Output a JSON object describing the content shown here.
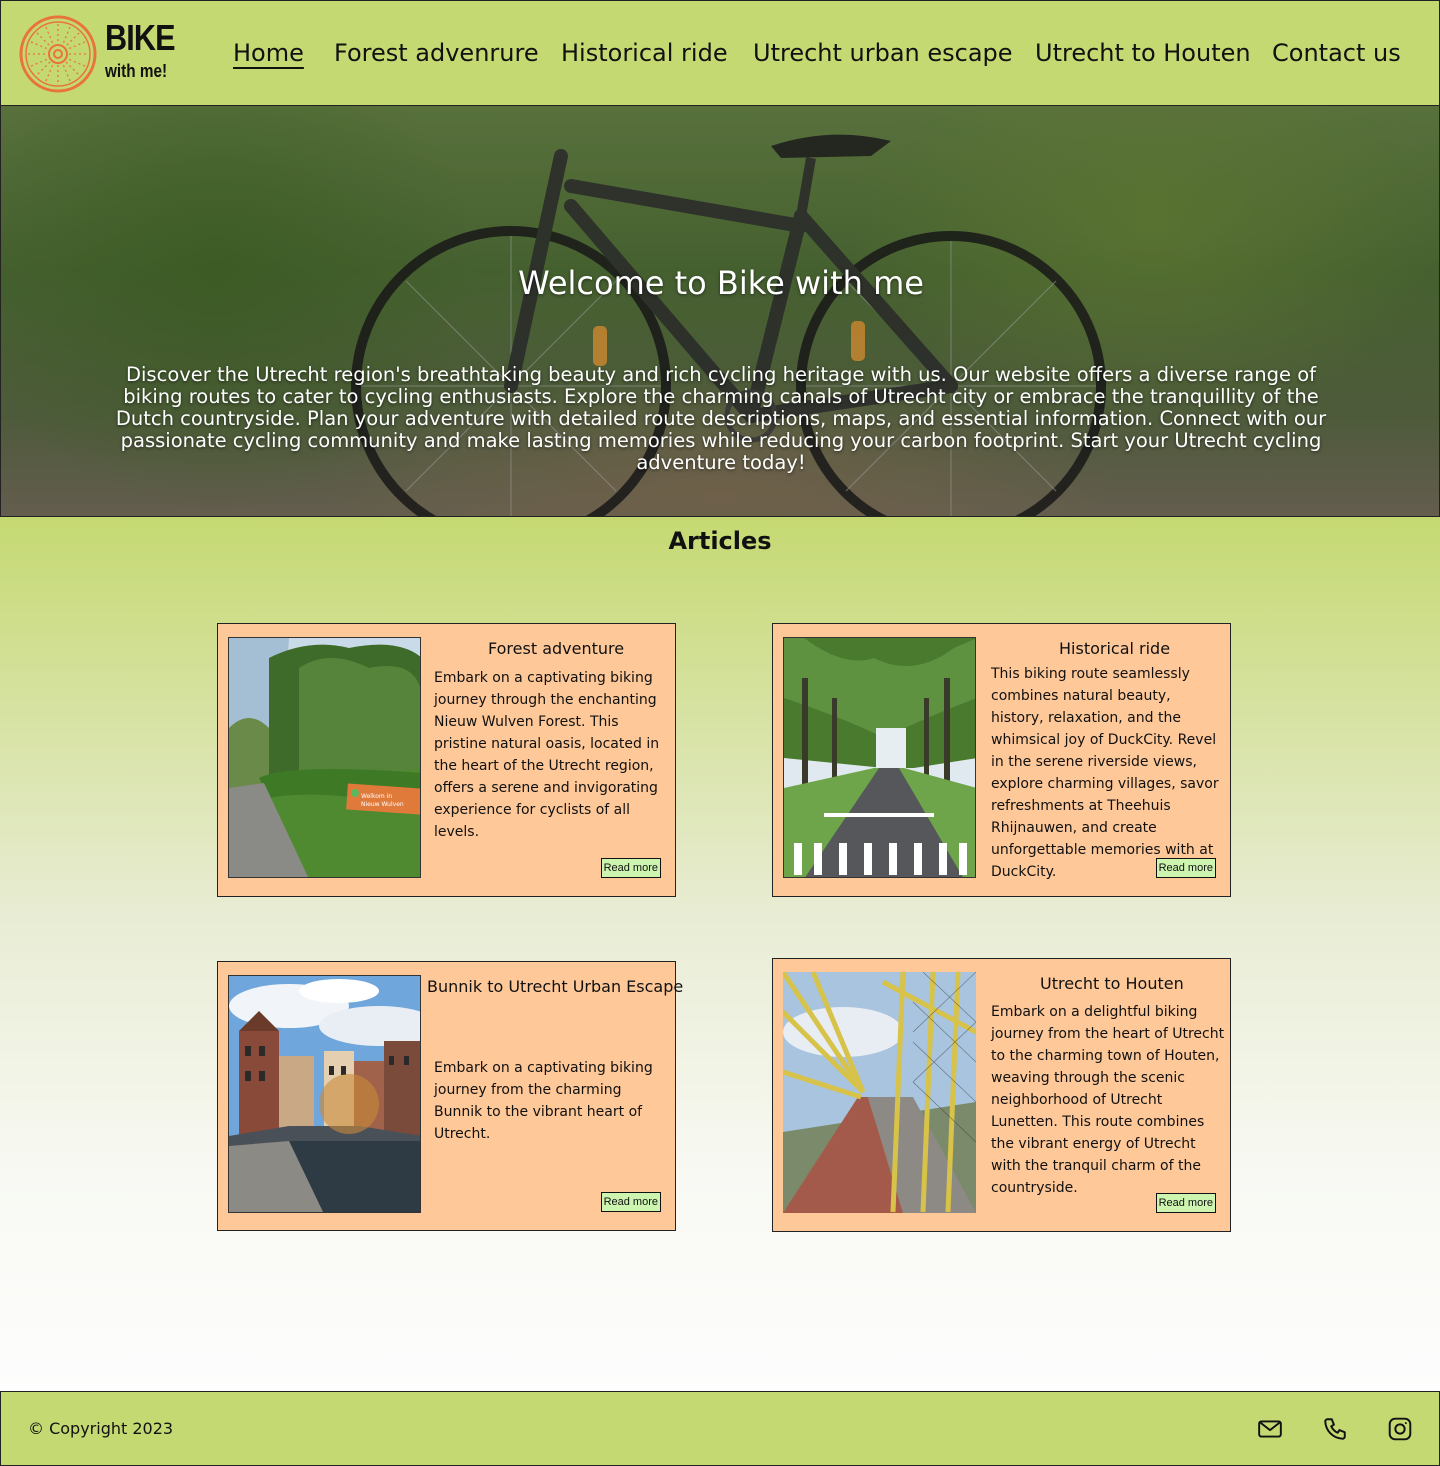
{
  "header": {
    "logo_word": "BIKE",
    "logo_sub": "with me!",
    "nav": [
      "Home",
      "Forest advenrure",
      "Historical ride",
      "Utrecht urban escape",
      "Utrecht to Houten",
      "Contact us"
    ],
    "active": "Home"
  },
  "hero": {
    "title": "Welcome to Bike with me",
    "text": "Discover the Utrecht region's breathtaking beauty and rich cycling heritage with us. Our website offers a diverse range of biking routes to cater to cycling enthusiasts. Explore the charming canals of Utrecht city or embrace the tranquillity of the Dutch countryside. Plan your adventure with detailed route descriptions, maps, and essential information. Connect with our passionate cycling community and make lasting memories while reducing your carbon footprint. Start your Utrecht cycling adventure today!"
  },
  "articles": {
    "heading": "Articles",
    "items": [
      {
        "title": "Forest adventure",
        "desc": "Embark on a captivating biking journey through the enchanting Nieuw Wulven Forest. This pristine natural oasis, located in the heart of the Utrecht region, offers a serene and invigorating experience for cyclists of all levels.",
        "button": "Read more",
        "sign_text": "Welkom in Nieuw Wulven"
      },
      {
        "title": "Historical ride",
        "desc": "This biking route seamlessly combines natural beauty, history, relaxation, and the whimsical joy of DuckCity. Revel in the serene riverside views, explore charming villages, savor refreshments at Theehuis Rhijnauwen, and create unforgettable memories with at DuckCity.",
        "button": "Read more"
      },
      {
        "title": "Bunnik to Utrecht Urban Escape",
        "desc": "Embark on a captivating biking journey from the charming Bunnik to the vibrant heart of Utrecht.",
        "button": "Read more"
      },
      {
        "title": "Utrecht to Houten",
        "desc": "Embark on a delightful biking journey from the heart of Utrecht to the charming town of Houten, weaving through the scenic neighborhood of Utrecht Lunetten. This route combines the vibrant energy of Utrecht with the tranquil charm of the countryside.",
        "button": "Read more"
      }
    ]
  },
  "footer": {
    "copyright": "© Copyright 2023",
    "icons": [
      "mail-icon",
      "phone-icon",
      "instagram-icon"
    ]
  },
  "colors": {
    "header_bg": "#c5d972",
    "card_bg": "#fec899",
    "button_bg": "#cdf5b0",
    "logo_orange": "#e8743b"
  }
}
